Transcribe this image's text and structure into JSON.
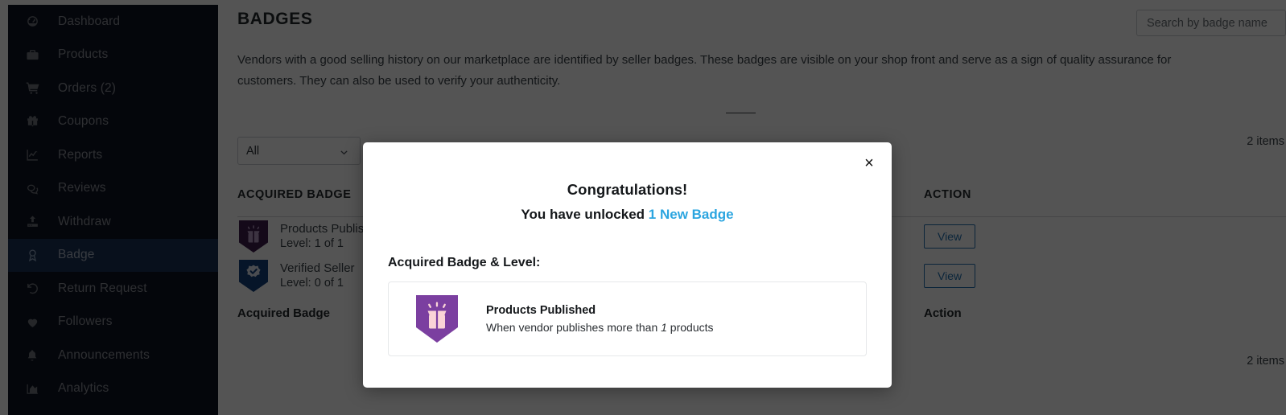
{
  "sidebar": {
    "items": [
      {
        "label": "Dashboard",
        "icon": "gauge-icon",
        "active": false
      },
      {
        "label": "Products",
        "icon": "briefcase-icon",
        "active": false
      },
      {
        "label": "Orders (2)",
        "icon": "cart-icon",
        "active": false
      },
      {
        "label": "Coupons",
        "icon": "gift-icon",
        "active": false
      },
      {
        "label": "Reports",
        "icon": "line-chart-icon",
        "active": false
      },
      {
        "label": "Reviews",
        "icon": "comments-icon",
        "active": false
      },
      {
        "label": "Withdraw",
        "icon": "upload-icon",
        "active": false
      },
      {
        "label": "Badge",
        "icon": "award-icon",
        "active": true
      },
      {
        "label": "Return Request",
        "icon": "undo-icon",
        "active": false
      },
      {
        "label": "Followers",
        "icon": "heart-icon",
        "active": false
      },
      {
        "label": "Announcements",
        "icon": "bell-icon",
        "active": false
      },
      {
        "label": "Analytics",
        "icon": "bar-chart-icon",
        "active": false
      }
    ],
    "active_background": "#1b3257",
    "background": "#0d1322"
  },
  "header": {
    "title": "BADGES",
    "search_placeholder": "Search by badge name",
    "search_value": ""
  },
  "intro": {
    "text": "Vendors with a good selling history on our marketplace are identified by seller badges. These badges are visible on your shop front and serve as a sign of quality assurance for customers. They can also be used to verify your authenticity."
  },
  "toolbar": {
    "filter_selected": "All",
    "filter_options": [
      "All"
    ],
    "items_count_top": "2 items",
    "items_count_bottom": "2 items"
  },
  "table": {
    "columns": [
      {
        "header": "ACQUIRED BADGE"
      },
      {
        "header": ""
      },
      {
        "header": "ACTION"
      }
    ],
    "rows": [
      {
        "badge_name": "Products Published",
        "level": "Level: 1 of 1",
        "badge_color": "#3d1c4c",
        "action_label": "View"
      },
      {
        "badge_name": "Verified Seller",
        "level": "Level: 0 of 1",
        "badge_color": "#14427d",
        "action_label": "View"
      }
    ],
    "footer": [
      {
        "label": "Acquired Badge"
      },
      {
        "label": ""
      },
      {
        "label": "Action"
      }
    ]
  },
  "modal": {
    "close_label": "×",
    "heading": "Congratulations!",
    "sub_prefix": "You have unlocked ",
    "sub_highlight": "1 New Badge",
    "highlight_color": "#2ba5e0",
    "acquired_label": "Acquired Badge & Level:",
    "badge": {
      "title": "Products Published",
      "desc_prefix": "When vendor publishes more than ",
      "desc_number": "1",
      "desc_suffix": " products",
      "color": "#7b3fa0"
    }
  }
}
